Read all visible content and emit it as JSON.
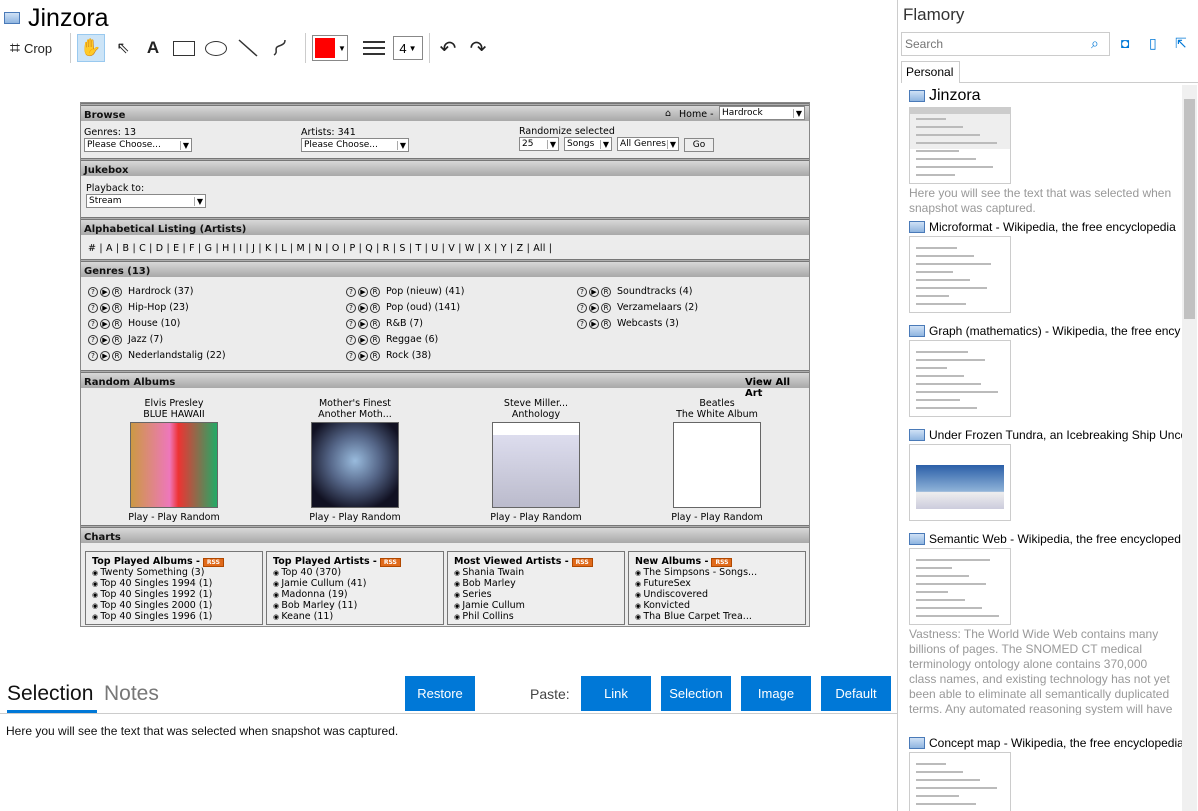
{
  "window": {
    "title": "Jinzora"
  },
  "toolbar": {
    "crop": "Crop",
    "line_width": "4",
    "color": "#ff0000"
  },
  "snapshot": {
    "browse": {
      "bar": "Browse",
      "home": "Home -",
      "home_select": "Hardrock",
      "genres_label": "Genres: 13",
      "genres_select": "Please Choose...",
      "artists_label": "Artists: 341",
      "artists_select": "Please Choose...",
      "randomize_label": "Randomize selected",
      "rand_count": "25",
      "rand_type": "Songs",
      "rand_genre": "All Genres",
      "go": "Go"
    },
    "jukebox": {
      "bar": "Jukebox",
      "playback_label": "Playback to:",
      "playback_select": "Stream"
    },
    "alpha": {
      "bar": "Alphabetical Listing (Artists)",
      "letters": "# | A | B | C | D | E | F | G | H | I | J | K | L | M | N | O | P | Q | R | S | T | U | V | W | X | Y | Z | All |"
    },
    "genres": {
      "bar": "Genres (13)",
      "items": [
        "Hardrock (37)",
        "Hip-Hop (23)",
        "House (10)",
        "Jazz (7)",
        "Nederlandstalig (22)",
        "Pop (nieuw) (41)",
        "Pop (oud) (141)",
        "R&B (7)",
        "Reggae (6)",
        "Rock (38)",
        "Soundtracks (4)",
        "Verzamelaars (2)",
        "Webcasts (3)"
      ]
    },
    "random": {
      "bar": "Random Albums",
      "view_all": "View All Art",
      "albums": [
        {
          "artist": "Elvis Presley",
          "album": "BLUE HAWAII",
          "play": "Play - Play Random"
        },
        {
          "artist": "Mother's Finest",
          "album": "Another Moth...",
          "play": "Play - Play Random"
        },
        {
          "artist": "Steve Miller...",
          "album": "Anthology",
          "play": "Play - Play Random"
        },
        {
          "artist": "Beatles",
          "album": "The White Album",
          "play": "Play - Play Random"
        }
      ]
    },
    "charts": {
      "bar": "Charts",
      "rss": "RSS",
      "boxes": [
        {
          "title": "Top Played Albums -",
          "items": [
            "Twenty Something (3)",
            "Top 40 Singles 1994 (1)",
            "Top 40 Singles 1992 (1)",
            "Top 40 Singles 2000 (1)",
            "Top 40 Singles 1996 (1)"
          ]
        },
        {
          "title": "Top Played Artists -",
          "items": [
            "Top 40 (370)",
            "Jamie Cullum (41)",
            "Madonna (19)",
            "Bob Marley (11)",
            "Keane (11)"
          ]
        },
        {
          "title": "Most Viewed Artists -",
          "items": [
            "Shania Twain",
            "Bob Marley",
            "Series",
            "Jamie Cullum",
            "Phil Collins"
          ]
        },
        {
          "title": "New Albums -",
          "items": [
            "The Simpsons - Songs...",
            "FutureSex",
            "Undiscovered",
            "Konvicted",
            "Tha Blue Carpet Trea..."
          ]
        }
      ]
    }
  },
  "bottom": {
    "tab_selection": "Selection",
    "tab_notes": "Notes",
    "restore": "Restore",
    "paste": "Paste:",
    "link": "Link",
    "selection": "Selection",
    "image": "Image",
    "default": "Default",
    "text": "Here you will see the text that was selected when snapshot was captured."
  },
  "sidebar": {
    "app": "Flamory",
    "search_placeholder": "Search",
    "tab": "Personal",
    "items": [
      {
        "title": "Jinzora",
        "desc": "Here you will see the text that was selected when snapshot was captured."
      },
      {
        "title": "Microformat - Wikipedia, the free encyclopedia",
        "desc": ""
      },
      {
        "title": "Graph (mathematics) - Wikipedia, the free ency",
        "desc": ""
      },
      {
        "title": "Under Frozen Tundra, an Icebreaking Ship Unco",
        "desc": ""
      },
      {
        "title": "Semantic Web - Wikipedia, the free encycloped",
        "desc": "Vastness: The World Wide Web contains many billions of pages. The SNOMED CT medical terminology ontology alone contains 370,000 class names, and existing technology has not yet been able to eliminate all semantically duplicated terms. Any automated reasoning system will have to deal with truly huge inputs."
      },
      {
        "title": "Concept map - Wikipedia, the free encyclopedia",
        "desc": ""
      }
    ]
  }
}
